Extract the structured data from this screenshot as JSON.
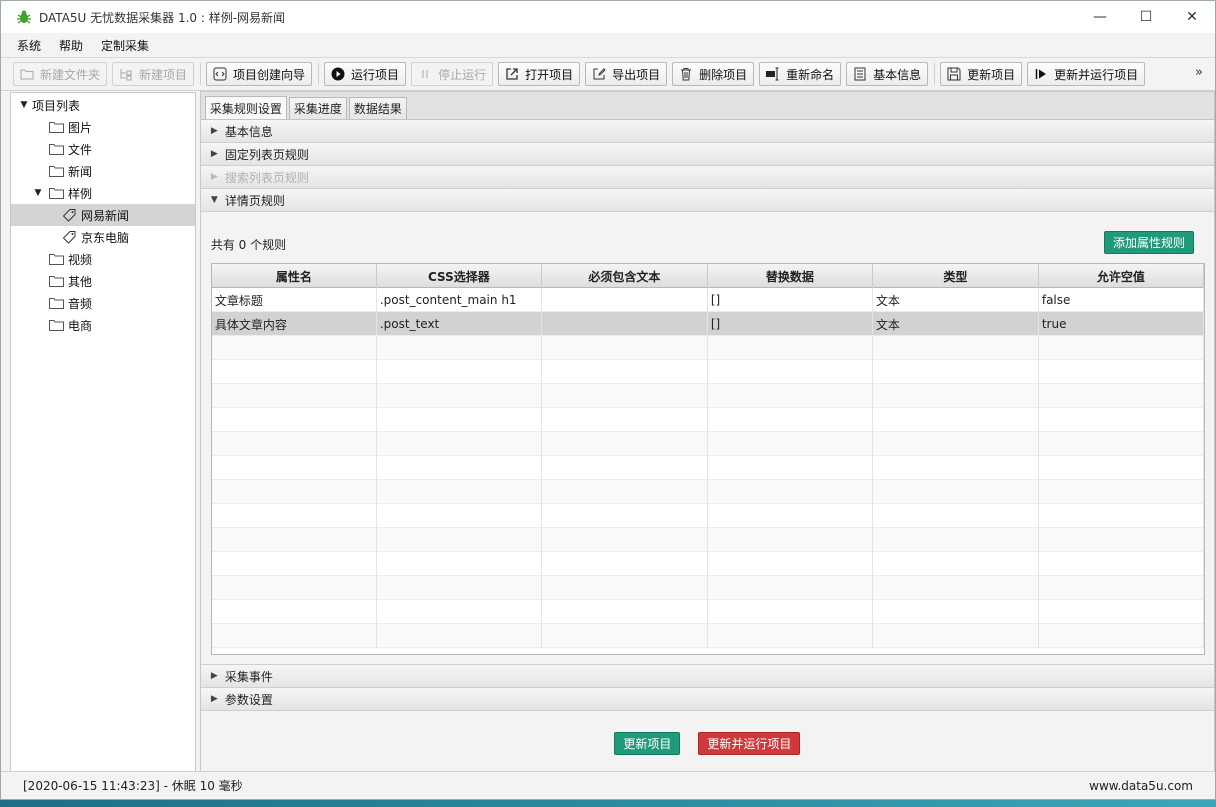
{
  "window": {
    "title": "DATA5U 无忧数据采集器 1.0 : 样例-网易新闻",
    "controls": [
      "—",
      "☐",
      "✕"
    ]
  },
  "menu": [
    "系统",
    "帮助",
    "定制采集"
  ],
  "toolbar": {
    "new_folder": "新建文件夹",
    "new_project": "新建项目",
    "wizard": "项目创建向导",
    "run": "运行项目",
    "stop": "停止运行",
    "open": "打开项目",
    "export": "导出项目",
    "delete": "删除项目",
    "rename": "重新命名",
    "info": "基本信息",
    "update": "更新项目",
    "update_run": "更新并运行项目",
    "more": "»"
  },
  "tree": {
    "root": "项目列表",
    "items": [
      {
        "label": "图片"
      },
      {
        "label": "文件"
      },
      {
        "label": "新闻"
      },
      {
        "label": "样例"
      },
      {
        "label": "网易新闻"
      },
      {
        "label": "京东电脑"
      },
      {
        "label": "视频"
      },
      {
        "label": "其他"
      },
      {
        "label": "音频"
      },
      {
        "label": "电商"
      }
    ]
  },
  "tabs": [
    "采集规则设置",
    "采集进度",
    "数据结果"
  ],
  "sections": {
    "basic": "基本信息",
    "fixed_list": "固定列表页规则",
    "search_list": "搜索列表页规则",
    "detail": "详情页规则",
    "events": "采集事件",
    "params": "参数设置"
  },
  "detail": {
    "count_text": "共有 0 个规则",
    "add_button": "添加属性规则",
    "columns": [
      "属性名",
      "CSS选择器",
      "必须包含文本",
      "替换数据",
      "类型",
      "允许空值"
    ],
    "rows": [
      [
        "文章标题",
        ".post_content_main h1",
        "",
        "[]",
        "文本",
        "false"
      ],
      [
        "具体文章内容",
        ".post_text",
        "",
        "[]",
        "文本",
        "true"
      ]
    ]
  },
  "buttons": {
    "update": "更新项目",
    "update_run": "更新并运行项目"
  },
  "status": {
    "left": "[2020-06-15 11:43:23] - 休眠 10 毫秒",
    "right": "www.data5u.com"
  },
  "colors": {
    "accent_green": "#1f9a7a",
    "accent_red": "#d0393b"
  }
}
